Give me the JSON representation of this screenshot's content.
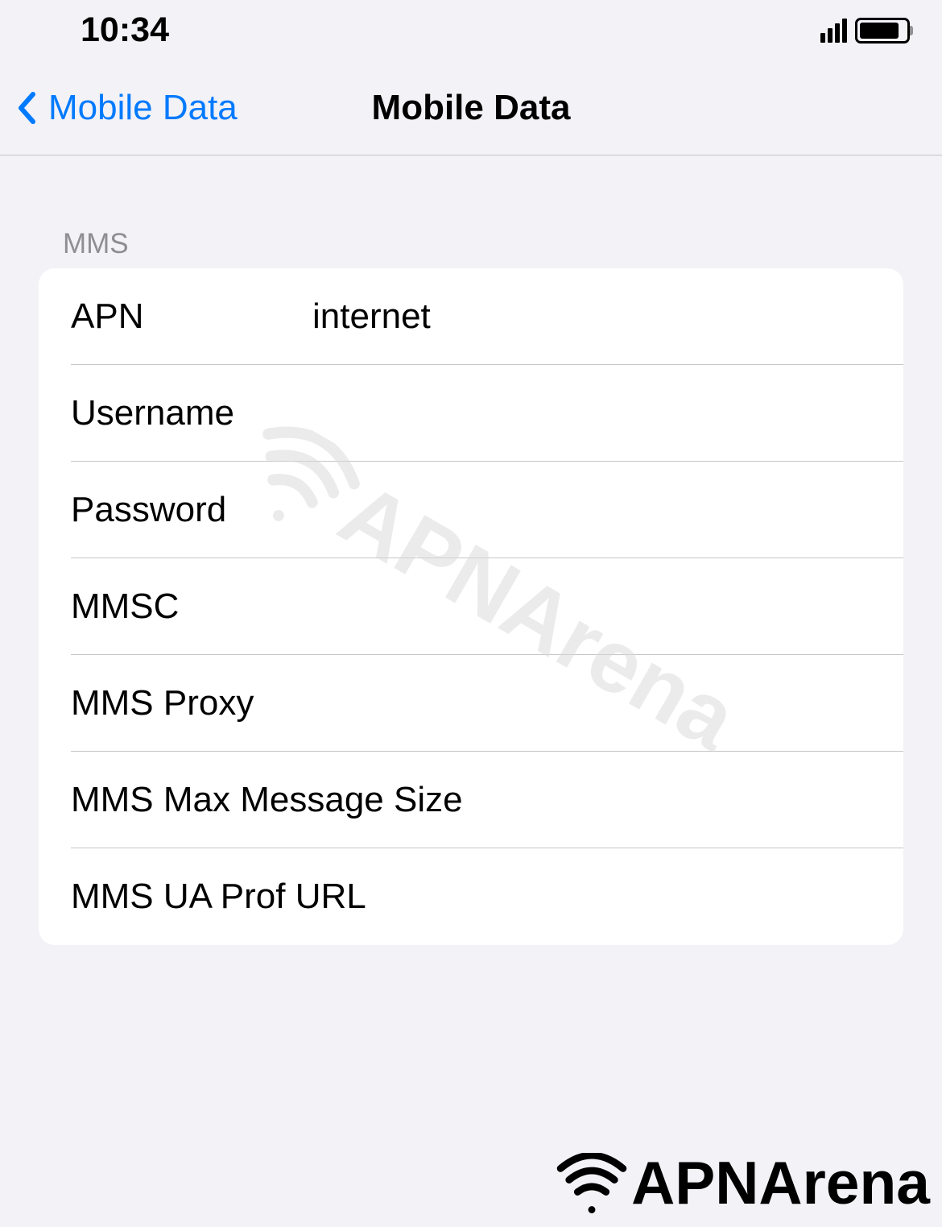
{
  "statusBar": {
    "time": "10:34"
  },
  "navBar": {
    "backLabel": "Mobile Data",
    "title": "Mobile Data"
  },
  "section": {
    "header": "MMS",
    "rows": [
      {
        "label": "APN",
        "value": "internet"
      },
      {
        "label": "Username",
        "value": ""
      },
      {
        "label": "Password",
        "value": ""
      },
      {
        "label": "MMSC",
        "value": ""
      },
      {
        "label": "MMS Proxy",
        "value": ""
      },
      {
        "label": "MMS Max Message Size",
        "value": ""
      },
      {
        "label": "MMS UA Prof URL",
        "value": ""
      }
    ]
  },
  "watermark": {
    "text": "APNArena"
  }
}
